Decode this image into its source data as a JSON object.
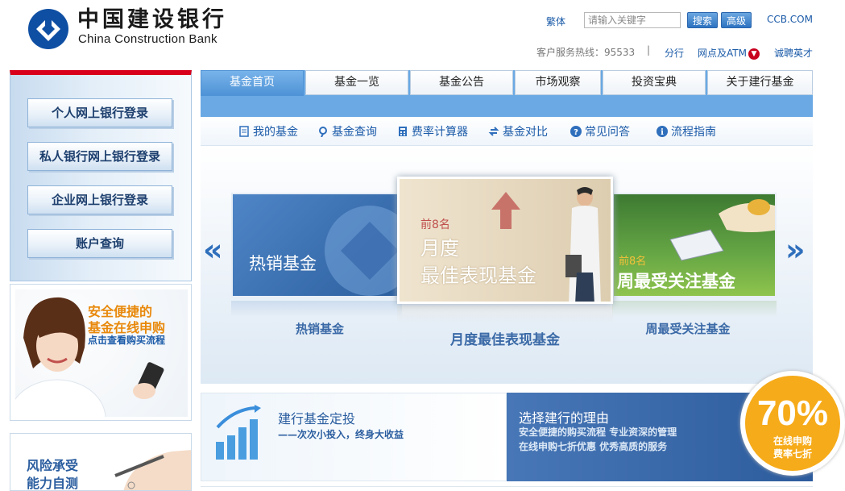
{
  "header": {
    "logo_cn": "中国建设银行",
    "logo_en": "China Construction Bank",
    "traditional": "繁体",
    "search_placeholder": "请输入关键字",
    "search_button": "搜索",
    "advanced_button": "高级",
    "site_link": "CCB.COM",
    "hotline": "客户服务热线：95533",
    "separator": "|",
    "branch": "分行",
    "atm": "网点及ATM",
    "careers": "诚聘英才"
  },
  "login": {
    "buttons": [
      {
        "label": "个人网上银行登录"
      },
      {
        "label": "私人银行网上银行登录"
      },
      {
        "label": "企业网上银行登录"
      },
      {
        "label": "账户查询"
      }
    ]
  },
  "promo_online": {
    "line1": "安全便捷的",
    "line2": "基金在线申购",
    "line3": "点击查看购买流程"
  },
  "promo_risk": {
    "line1": "风险承受",
    "line2": "能力自测"
  },
  "tabs": [
    {
      "label": "基金首页"
    },
    {
      "label": "基金一览"
    },
    {
      "label": "基金公告"
    },
    {
      "label": "市场观察"
    },
    {
      "label": "投资宝典"
    },
    {
      "label": "关于建行基金"
    }
  ],
  "subnav": [
    {
      "label": "我的基金",
      "icon": "document-icon"
    },
    {
      "label": "基金查询",
      "icon": "search-icon"
    },
    {
      "label": "费率计算器",
      "icon": "calculator-icon"
    },
    {
      "label": "基金对比",
      "icon": "swap-icon"
    },
    {
      "label": "常见问答",
      "icon": "question-icon"
    },
    {
      "label": "流程指南",
      "icon": "info-icon"
    }
  ],
  "carousel": {
    "left_arrow": "«",
    "right_arrow": "»",
    "hot": {
      "title": "热销基金",
      "caption": "热销基金"
    },
    "monthly": {
      "badge": "前8名",
      "line1": "月度",
      "line2": "最佳表现基金",
      "caption": "月度最佳表现基金"
    },
    "weekly": {
      "badge": "前8名",
      "title": "周最受关注基金",
      "caption": "周最受关注基金"
    }
  },
  "banner_invest": {
    "title": "建行基金定投",
    "subtitle": "——次次小投入，终身大收益"
  },
  "banner_reason": {
    "title": "选择建行的理由",
    "line1": "安全便捷的购买流程 专业资深的管理",
    "line2": "在线申购七折优惠 优秀高质的服务"
  },
  "badge": {
    "number": "70%",
    "line1": "在线申购",
    "line2": "费率七折"
  },
  "colors": {
    "brand_blue": "#1a5aa8",
    "brand_red": "#d8001a",
    "tab_blue": "#6aa9e4",
    "badge_orange": "#f6ab1a"
  }
}
